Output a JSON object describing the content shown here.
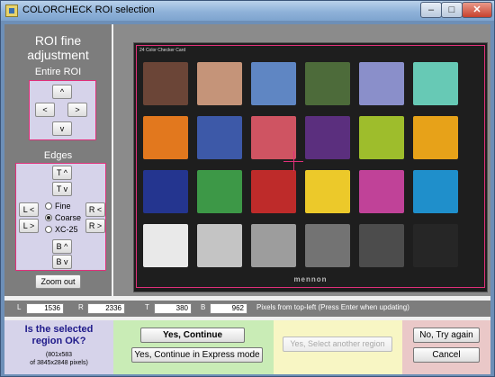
{
  "window": {
    "title": "COLORCHECK ROI selection",
    "controls": {
      "minimize": "–",
      "maximize": "□",
      "close": "✕"
    }
  },
  "left_panel": {
    "title_line1": "ROI fine",
    "title_line2": "adjustment",
    "entire_roi_label": "Entire ROI",
    "entire_buttons": {
      "up": "^",
      "left": "<",
      "right": ">",
      "down": "v"
    },
    "edges_label": "Edges",
    "edge_buttons": {
      "top_up": "T ^",
      "top_down": "T v",
      "left_left": "L <",
      "left_right": "L >",
      "right_left": "R <",
      "right_right": "R >",
      "bottom_up": "B ^",
      "bottom_down": "B v"
    },
    "step_options": [
      {
        "label": "Fine",
        "selected": false
      },
      {
        "label": "Coarse",
        "selected": true
      },
      {
        "label": "XC-25",
        "selected": false
      }
    ],
    "zoom_out": "Zoom out"
  },
  "image": {
    "card_label": "24 Color Checker Card",
    "brand": "mennon",
    "patch_colors": [
      "#6b4537",
      "#c59479",
      "#5f86c3",
      "#4d6b3a",
      "#8a8fca",
      "#67c9b5",
      "#e2781e",
      "#3d59a8",
      "#cf5462",
      "#5b2f7e",
      "#9ebd2c",
      "#e7a219",
      "#24358f",
      "#3d9847",
      "#be2b2a",
      "#ecc92a",
      "#c04298",
      "#1f8fcb",
      "#e9e9e9",
      "#c4c4c4",
      "#9d9d9d",
      "#737373",
      "#4c4c4c",
      "#262626"
    ]
  },
  "coords": {
    "L": {
      "label": "L",
      "value": "1536"
    },
    "R": {
      "label": "R",
      "value": "2336"
    },
    "T": {
      "label": "T",
      "value": "380"
    },
    "B": {
      "label": "B",
      "value": "962"
    },
    "note": "Pixels from top-left  (Press Enter when updating)"
  },
  "question": {
    "line1": "Is the selected",
    "line2": "region OK?",
    "sub1": "(801x583",
    "sub2": "of 3845x2848 pixels)"
  },
  "actions": {
    "yes_continue": "Yes, Continue",
    "yes_express": "Yes, Continue in Express mode",
    "yes_another": "Yes, Select another region",
    "no_try_again": "No, Try again",
    "cancel": "Cancel"
  }
}
